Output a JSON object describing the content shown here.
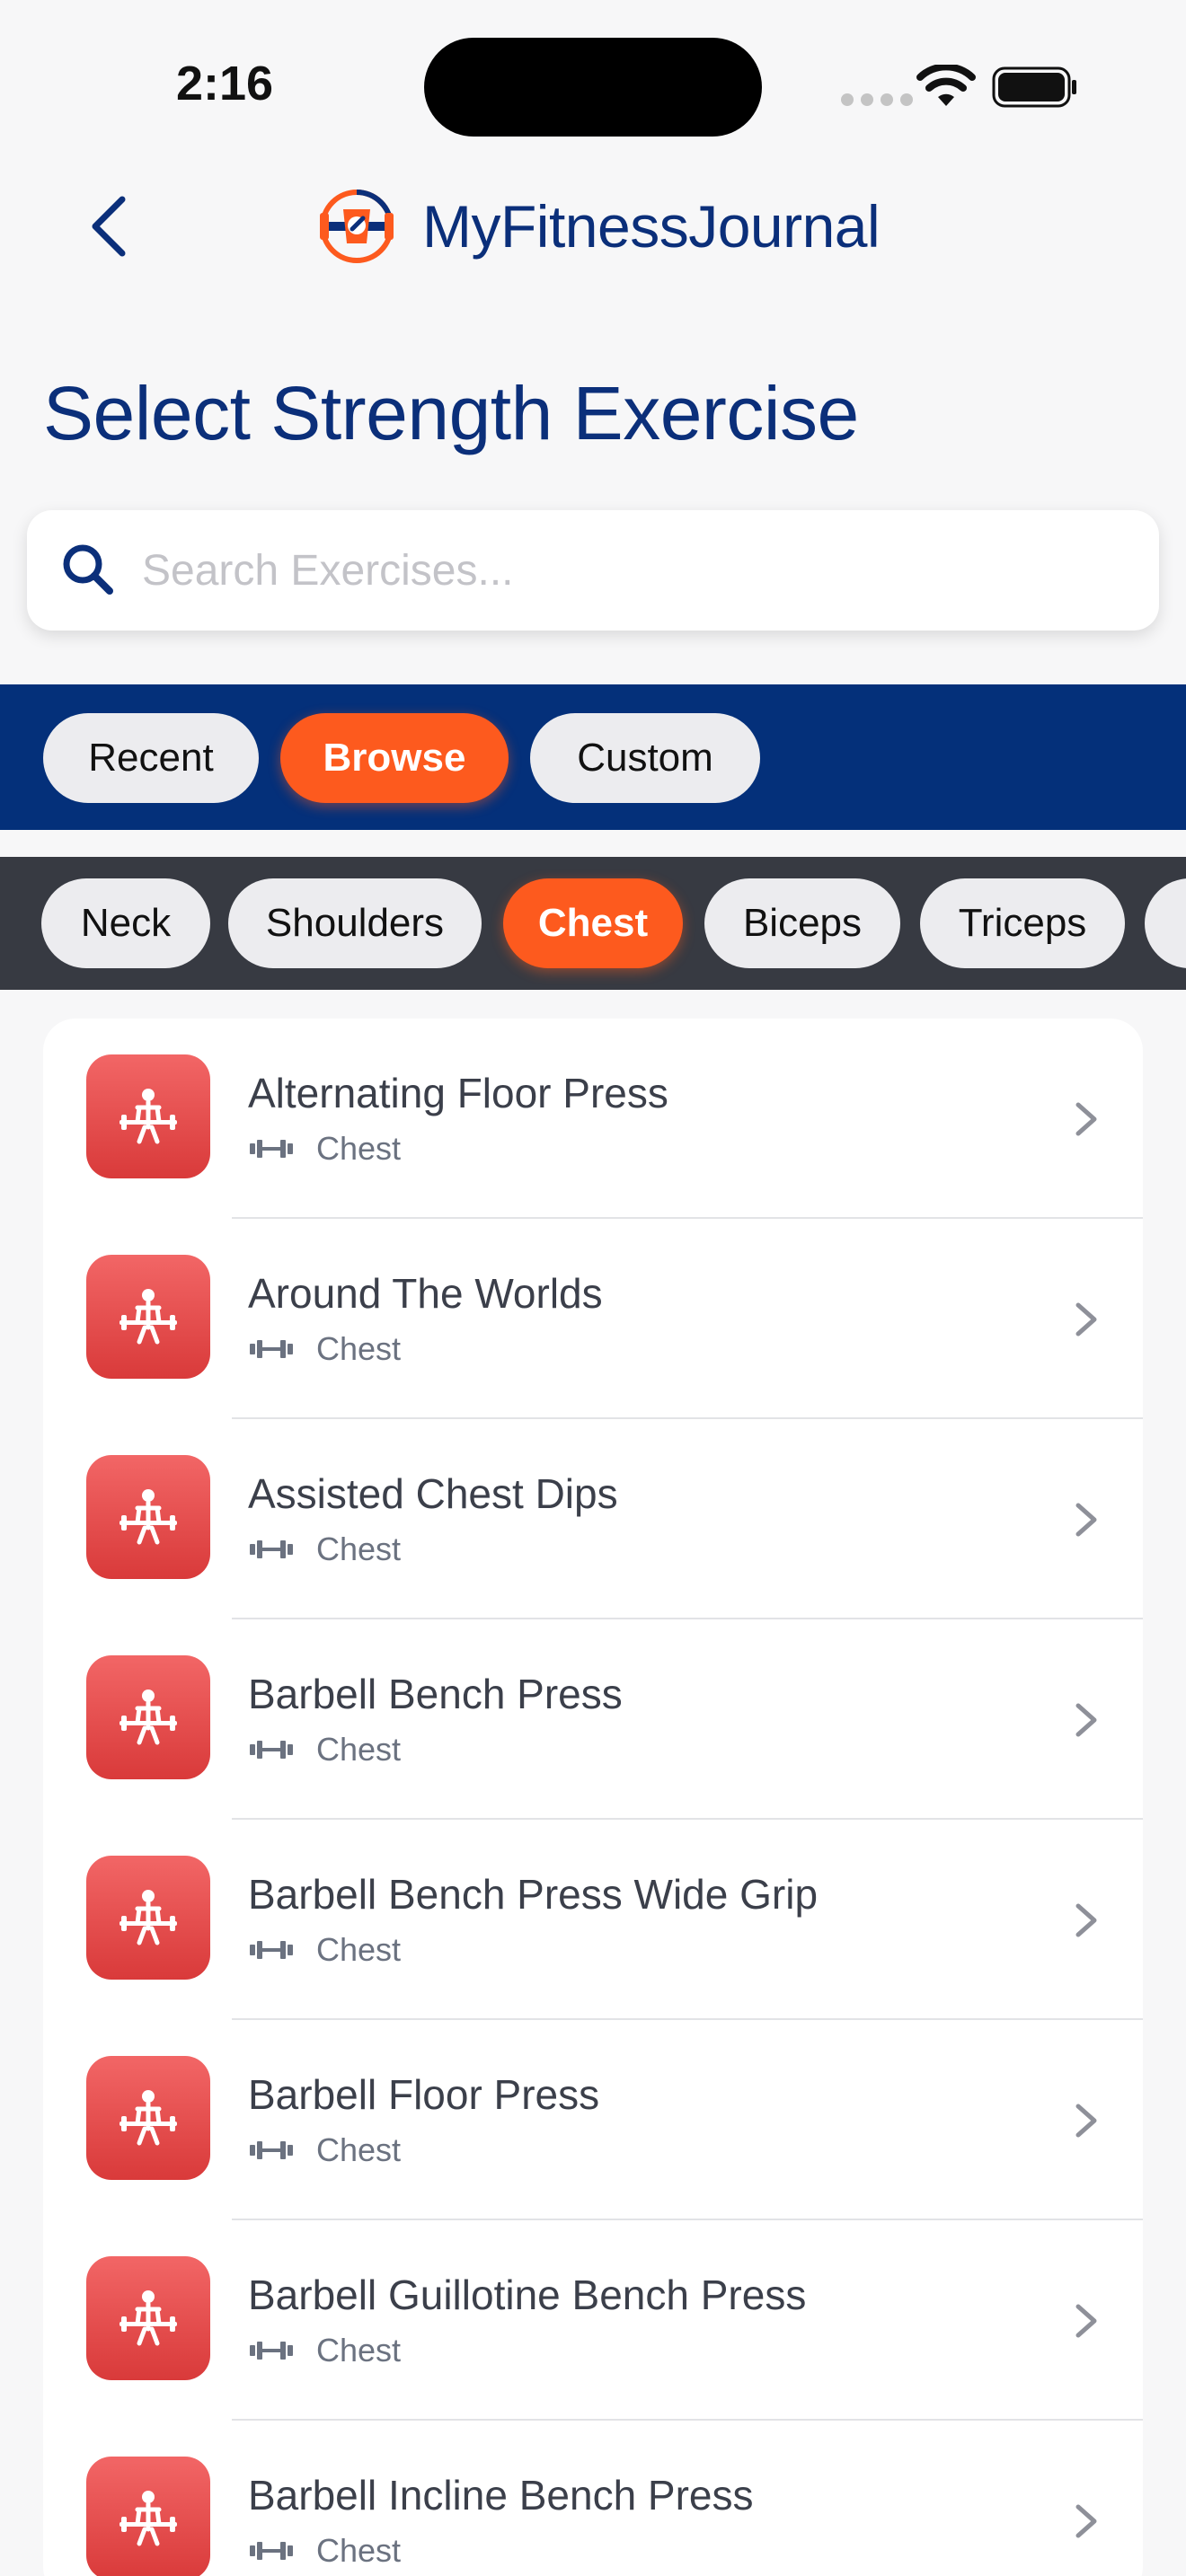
{
  "status_bar": {
    "time": "2:16"
  },
  "header": {
    "app_name": "MyFitnessJournal"
  },
  "page_title": "Select Strength Exercise",
  "search": {
    "placeholder": "Search Exercises...",
    "value": ""
  },
  "mode_tabs": [
    {
      "label": "Recent",
      "active": false
    },
    {
      "label": "Browse",
      "active": true
    },
    {
      "label": "Custom",
      "active": false
    }
  ],
  "categories": [
    {
      "label": "Neck",
      "active": false
    },
    {
      "label": "Shoulders",
      "active": false
    },
    {
      "label": "Chest",
      "active": true
    },
    {
      "label": "Biceps",
      "active": false
    },
    {
      "label": "Triceps",
      "active": false
    }
  ],
  "exercises": [
    {
      "name": "Alternating Floor Press",
      "muscle": "Chest"
    },
    {
      "name": "Around The Worlds",
      "muscle": "Chest"
    },
    {
      "name": "Assisted Chest Dips",
      "muscle": "Chest"
    },
    {
      "name": "Barbell Bench Press",
      "muscle": "Chest"
    },
    {
      "name": "Barbell Bench Press Wide Grip",
      "muscle": "Chest"
    },
    {
      "name": "Barbell Floor Press",
      "muscle": "Chest"
    },
    {
      "name": "Barbell Guillotine Bench Press",
      "muscle": "Chest"
    },
    {
      "name": "Barbell Incline Bench Press",
      "muscle": "Chest"
    }
  ],
  "colors": {
    "navy": "#0b2f7a",
    "mode_bar": "#04307a",
    "category_bar": "#373a42",
    "accent_orange": "#fd5a1e",
    "icon_red": "#e14848"
  },
  "icons": {
    "back": "chevron-left-icon",
    "search": "magnifier-icon",
    "exercise": "weightlifter-icon",
    "equipment": "dumbbell-icon",
    "row_action": "chevron-right-icon"
  }
}
